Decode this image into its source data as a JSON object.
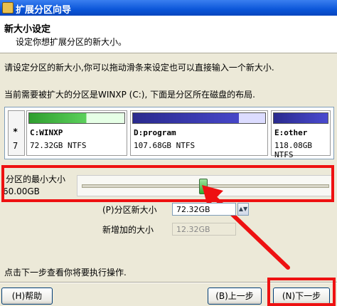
{
  "window": {
    "title": "扩展分区向导"
  },
  "header": {
    "title": "新大小设定",
    "subtitle": "设定你想扩展分区的新大小。"
  },
  "instructions": {
    "line1": "请设定分区的新大小,你可以拖动滑条来设定也可以直接输入一个新大小.",
    "line2": "当前需要被扩大的分区是WINXP (C:), 下面是分区所在磁盘的布局."
  },
  "disk_map": {
    "disk_star": "*",
    "disk_number": "7",
    "partitions": [
      {
        "name": "C:WINXP",
        "size": "72.32GB NTFS",
        "color": "#3cbc3c"
      },
      {
        "name": "D:program",
        "size": "107.68GB NTFS",
        "color": "#3a3ab4"
      },
      {
        "name": "E:other",
        "size": "118.08GB NTFS",
        "color": "#3a3ab4"
      }
    ]
  },
  "min_size": {
    "label": "分区的最小大小",
    "value": "60.00GB"
  },
  "slider": {
    "position_fraction": 0.49
  },
  "new_size": {
    "label": "(P)分区新大小",
    "value": "72.32GB"
  },
  "added_size": {
    "label": "新增加的大小",
    "value": "12.32GB"
  },
  "footer": {
    "hint": "点击下一步查看你将要执行操作."
  },
  "buttons": {
    "help": "(H)帮助",
    "back": "(B)上一步",
    "next": "(N)下一步"
  },
  "colors": {
    "highlight": "#e11111",
    "title_bar": "#0b56d9"
  }
}
